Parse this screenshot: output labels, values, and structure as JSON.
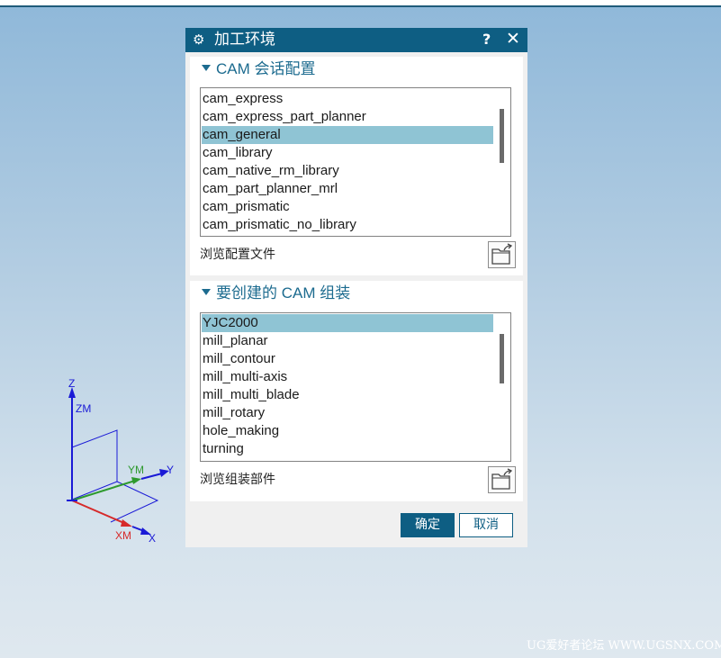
{
  "dialog": {
    "title": "加工环境",
    "title_icon": "gear-icon",
    "help_label": "?",
    "close_label": "✕",
    "session_group": {
      "title": "CAM 会话配置",
      "items": [
        "cam_express",
        "cam_express_part_planner",
        "cam_general",
        "cam_library",
        "cam_native_rm_library",
        "cam_part_planner_mrl",
        "cam_prismatic",
        "cam_prismatic_no_library"
      ],
      "selected": "cam_general",
      "browse_label": "浏览配置文件",
      "browse_icon": "open-folder-icon"
    },
    "setup_group": {
      "title": "要创建的 CAM 组装",
      "items": [
        "YJC2000",
        "mill_planar",
        "mill_contour",
        "mill_multi-axis",
        "mill_multi_blade",
        "mill_rotary",
        "hole_making",
        "turning"
      ],
      "selected": "YJC2000",
      "browse_label": "浏览组装部件",
      "browse_icon": "open-folder-icon"
    },
    "ok_label": "确定",
    "cancel_label": "取消"
  },
  "triad": {
    "labels": {
      "z": "Z",
      "zm": "ZM",
      "ym": "YM",
      "y": "Y",
      "xm": "XM",
      "x": "X"
    },
    "colors": {
      "z": "#1a1ad6",
      "y": "#1a1ad6",
      "ym": "#2e9a2e",
      "xm": "#d62a2a",
      "x": "#1a1ad6"
    }
  },
  "watermark": "UG爱好者论坛 WWW.UGSNX.COM",
  "colors": {
    "accent": "#0e5e83",
    "selection": "#8fc4d4",
    "group_title": "#1c6b8f"
  }
}
